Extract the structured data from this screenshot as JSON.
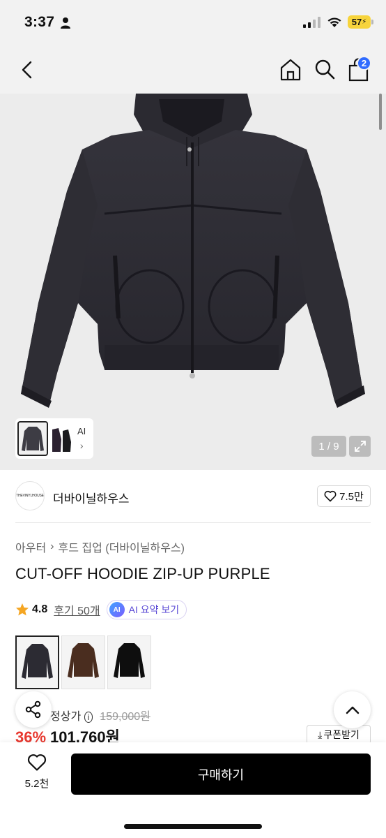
{
  "status_bar": {
    "time": "3:37",
    "battery": "57"
  },
  "header": {
    "cart_count": "2"
  },
  "gallery": {
    "thumb_ai_label": "AI",
    "counter": "1 / 9"
  },
  "brand": {
    "logo_text": "THEVINYLHOUSE",
    "name": "더바이닐하우스",
    "likes": "7.5만"
  },
  "category": {
    "parent": "아우터",
    "child": "후드 집업 (더바이닐하우스)"
  },
  "product": {
    "title": "CUT-OFF HOODIE ZIP-UP PURPLE"
  },
  "rating": {
    "score": "4.8",
    "reviews": "후기 50개",
    "ai_badge": "AI",
    "ai_summary": "AI 요약 보기"
  },
  "colors": [
    {
      "name": "purple",
      "hex": "#2c2b33"
    },
    {
      "name": "brown",
      "hex": "#4a2d1f"
    },
    {
      "name": "black",
      "hex": "#0e0e0e"
    }
  ],
  "price": {
    "original_label": "정상가",
    "original_price": "159,000원",
    "discount_rate": "36%",
    "sale_price": "101,760원",
    "coupon_label": "쿠폰받기"
  },
  "bottom_bar": {
    "wish_count": "5.2천",
    "buy_label": "구매하기"
  }
}
